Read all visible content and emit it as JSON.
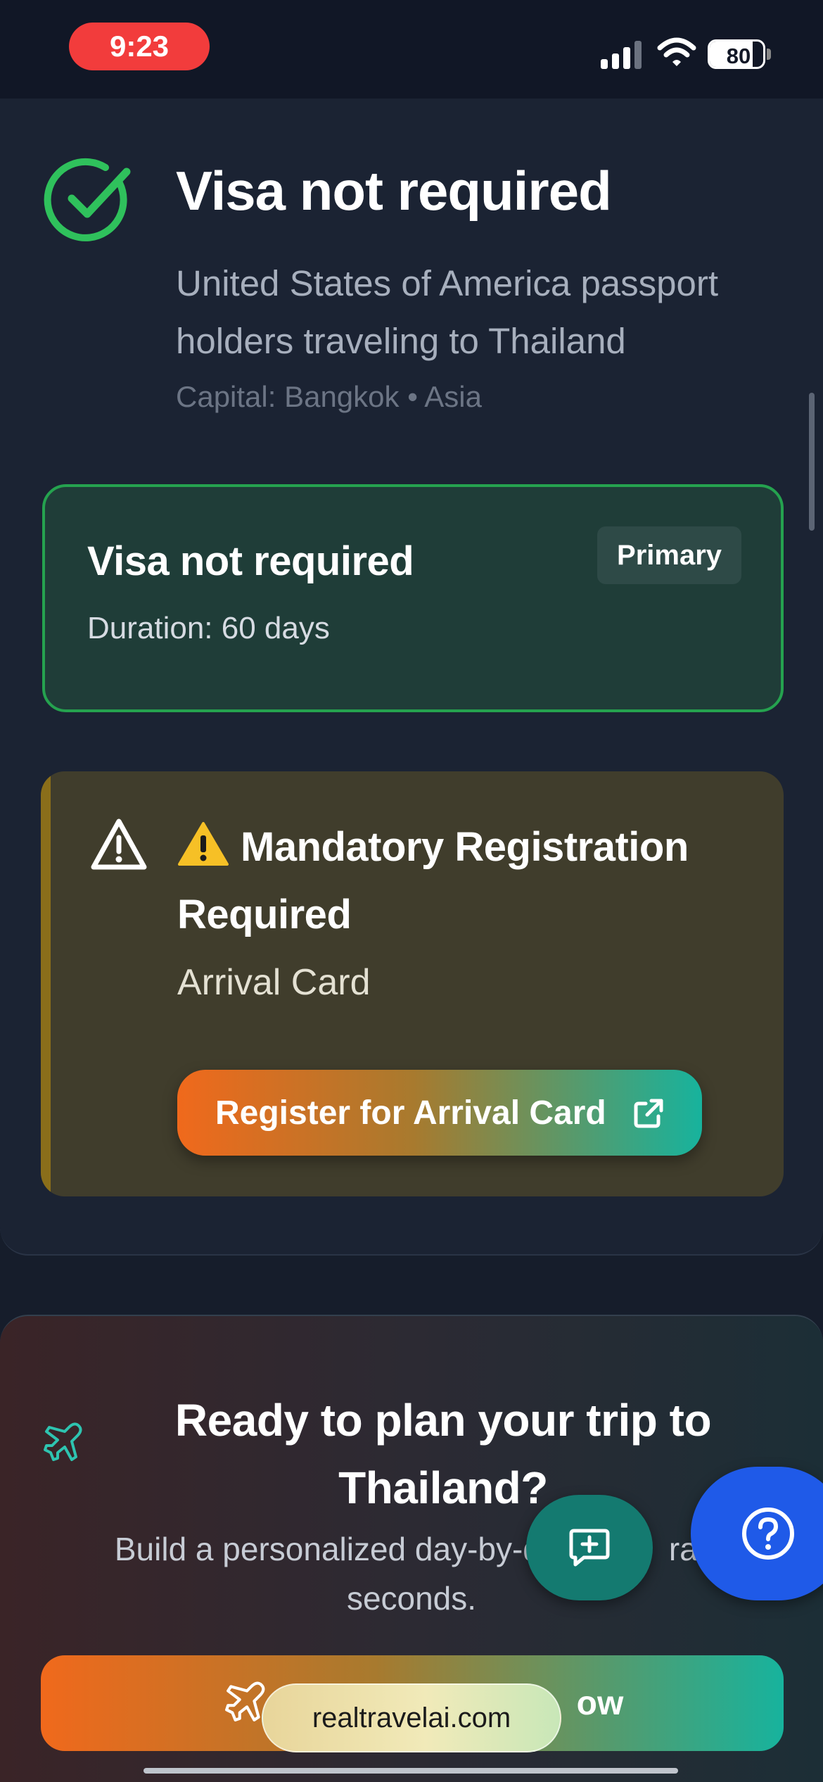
{
  "status_bar": {
    "time": "9:23",
    "battery_level": "80",
    "battery_fraction": 0.8,
    "icons": [
      "signal-icon",
      "wifi-icon",
      "battery-icon"
    ],
    "time_pill_color": "#f23c3c"
  },
  "visa_status": {
    "title": "Visa not required",
    "subtitle": "United States of America passport holders traveling to Thailand",
    "meta": "Capital: Bangkok • Asia",
    "icon": "check-circle-icon",
    "color": "#2fc15c"
  },
  "primary_card": {
    "title": "Visa not required",
    "duration": "Duration: 60 days",
    "badge": "Primary",
    "border_color": "#25a24f"
  },
  "registration_card": {
    "icon": "warning-icon",
    "emoji": "⚠️",
    "title": "Mandatory Registration Required",
    "subtitle": "Arrival Card",
    "button_label": "Register for Arrival Card",
    "button_icon": "external-link-icon"
  },
  "plan_card": {
    "icon": "plane-icon",
    "title": "Ready to plan your trip to Thailand?",
    "subtitle_visible_start": "Build a personalized day-by-d",
    "subtitle_visible_end": "rar",
    "subtitle_line2": "seconds.",
    "button_label_visible": "ow",
    "button_icon": "plane-icon"
  },
  "floating_buttons": {
    "chat": "chat-add-icon",
    "help": "help-icon"
  },
  "browser": {
    "url": "realtravelai.com"
  }
}
